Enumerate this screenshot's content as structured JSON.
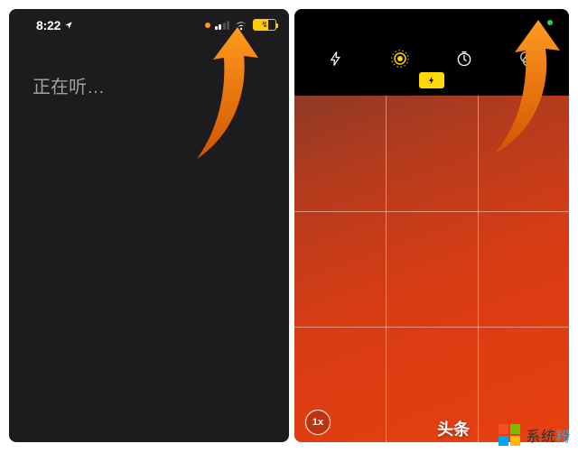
{
  "left": {
    "time": "8:22",
    "listening_text": "正在听…",
    "privacy_indicator": "microphone"
  },
  "right": {
    "privacy_indicator": "camera",
    "toolbar": {
      "flash_icon": "flash",
      "live_icon": "live-photo",
      "timer_icon": "timer",
      "filter_icon": "filters"
    },
    "flash_badge": "⚡",
    "zoom_label": "1x",
    "viewfinder_caption": "头条"
  },
  "watermark": {
    "brand_cn": "系统",
    "brand_accent": "粉"
  }
}
